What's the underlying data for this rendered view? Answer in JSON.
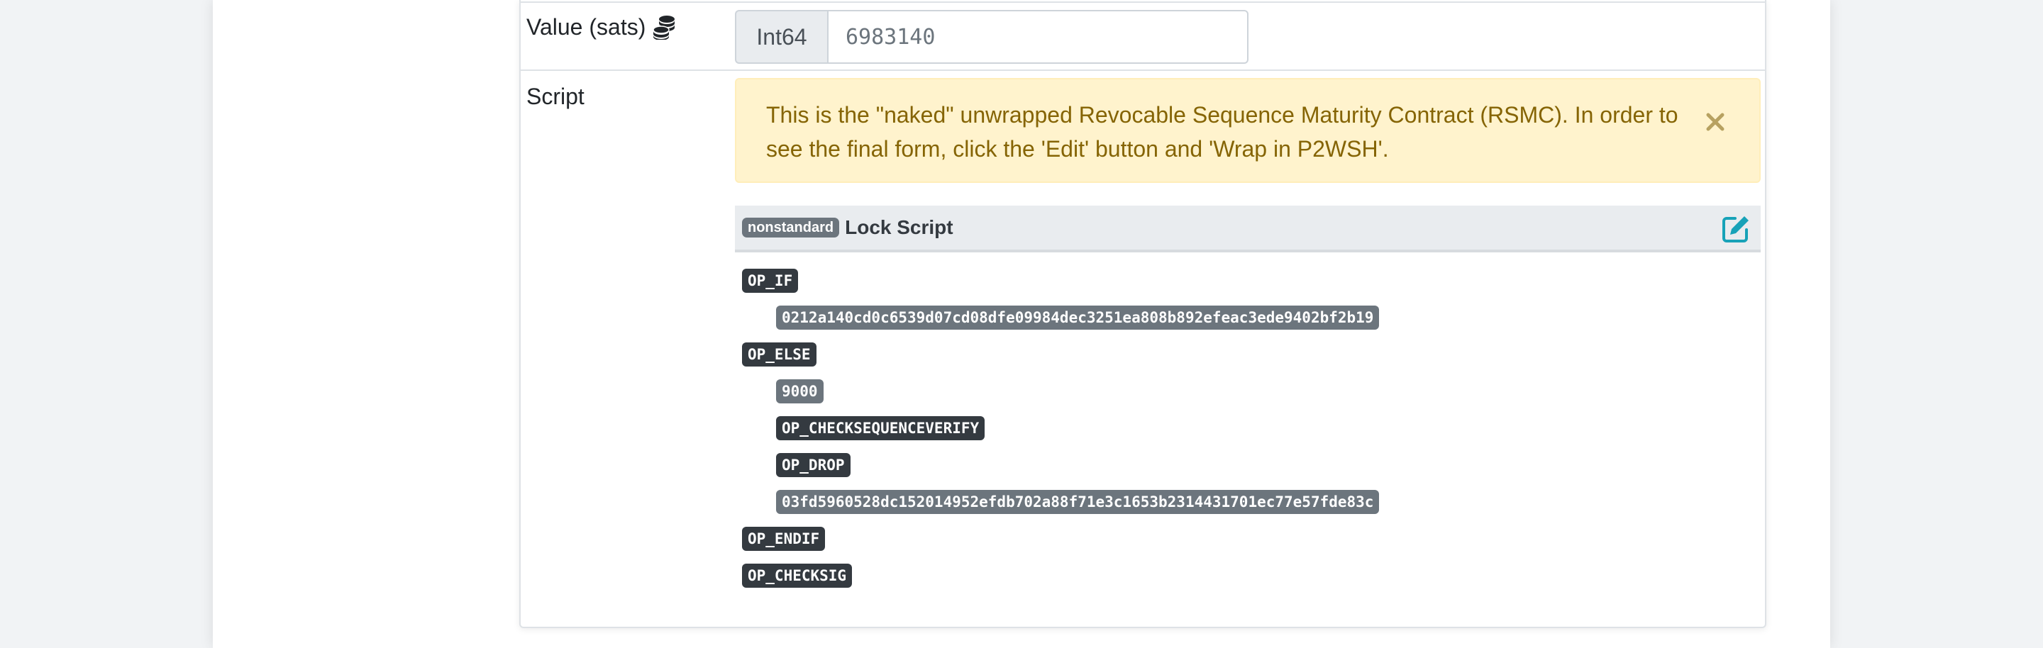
{
  "value_row": {
    "label": "Value (sats)",
    "icon": "coins-icon",
    "input_prefix": "Int64",
    "input_value": "6983140"
  },
  "script_row": {
    "label": "Script",
    "alert_text": "This is the \"naked\" unwrapped Revocable Sequence Maturity Contract (RSMC). In order to see the final form, click the 'Edit' button and 'Wrap in P2WSH'.",
    "close_icon": "close-icon"
  },
  "lock_script": {
    "badge": "nonstandard",
    "title": "Lock Script",
    "edit_icon": "edit-icon",
    "ops": [
      {
        "text": "OP_IF",
        "kind": "opcode",
        "indent": 0
      },
      {
        "text": "0212a140cd0c6539d07cd08dfe09984dec3251ea808b892efeac3ede9402bf2b19",
        "kind": "data",
        "indent": 1
      },
      {
        "text": "OP_ELSE",
        "kind": "opcode",
        "indent": 0
      },
      {
        "text": "9000",
        "kind": "data",
        "indent": 1
      },
      {
        "text": "OP_CHECKSEQUENCEVERIFY",
        "kind": "opcode",
        "indent": 1
      },
      {
        "text": "OP_DROP",
        "kind": "opcode",
        "indent": 1
      },
      {
        "text": "03fd5960528dc152014952efdb702a88f71e3c1653b2314431701ec77e57fde83c",
        "kind": "data",
        "indent": 1
      },
      {
        "text": "OP_ENDIF",
        "kind": "opcode",
        "indent": 0
      },
      {
        "text": "OP_CHECKSIG",
        "kind": "opcode",
        "indent": 0
      }
    ]
  },
  "colors": {
    "alert_background": "#fff3cd",
    "alert_text": "#856404",
    "opcode_badge": "#343a40",
    "data_badge": "#6c757d",
    "edit_icon": "#17a2b8"
  }
}
